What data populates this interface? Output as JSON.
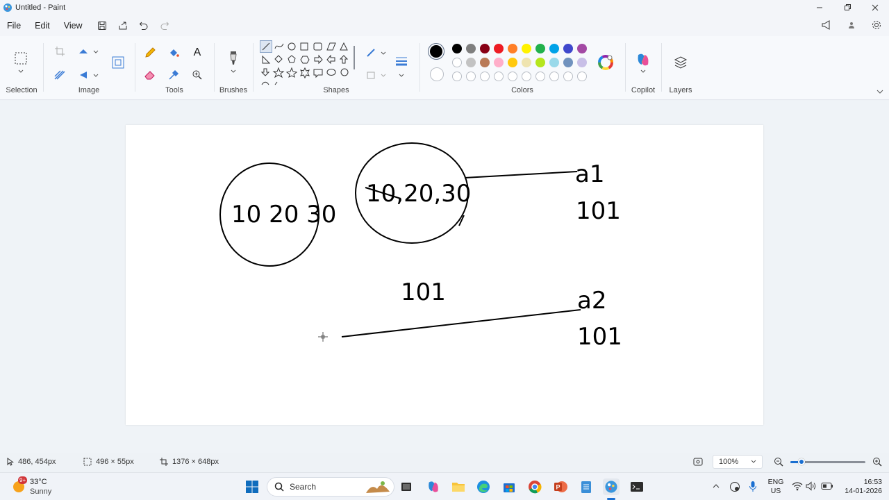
{
  "window": {
    "title": "Untitled - Paint"
  },
  "menu": {
    "file": "File",
    "edit": "Edit",
    "view": "View"
  },
  "ribbon": {
    "groups": {
      "selection": "Selection",
      "image": "Image",
      "tools": "Tools",
      "brushes": "Brushes",
      "shapes": "Shapes",
      "colors": "Colors",
      "copilot": "Copilot",
      "layers": "Layers"
    },
    "tools": {
      "text_tool_glyph": "A"
    },
    "colors": {
      "primary": "#000000",
      "secondary": "#ffffff",
      "palette_row1": [
        "#000000",
        "#7f7f7f",
        "#880015",
        "#ed1c24",
        "#ff7f27",
        "#fff200",
        "#22b14c",
        "#00a2e8",
        "#3f48cc",
        "#a349a4"
      ],
      "palette_row2": [
        "#ffffff",
        "#c3c3c3",
        "#b97a57",
        "#ffaec9",
        "#ffc90e",
        "#efe4b0",
        "#b5e61d",
        "#99d9ea",
        "#7092be",
        "#c8bfe7"
      ]
    }
  },
  "canvas": {
    "texts": {
      "circle1": "10 20 30",
      "circle2": "10,20,30",
      "under_circle2": "101",
      "a1_label": "a1",
      "a1_value": "101",
      "a2_label": "a2",
      "a2_value": "101"
    }
  },
  "status": {
    "cursor_pos": "486, 454px",
    "selection_size": "496 × 55px",
    "canvas_size": "1376 × 648px",
    "zoom": "100%"
  },
  "taskbar": {
    "weather_temp": "33°C",
    "weather_desc": "Sunny",
    "weather_badge": "9+",
    "search_placeholder": "Search",
    "lang_top": "ENG",
    "lang_bottom": "US",
    "time": "16:53",
    "date": "14-01-2026"
  }
}
